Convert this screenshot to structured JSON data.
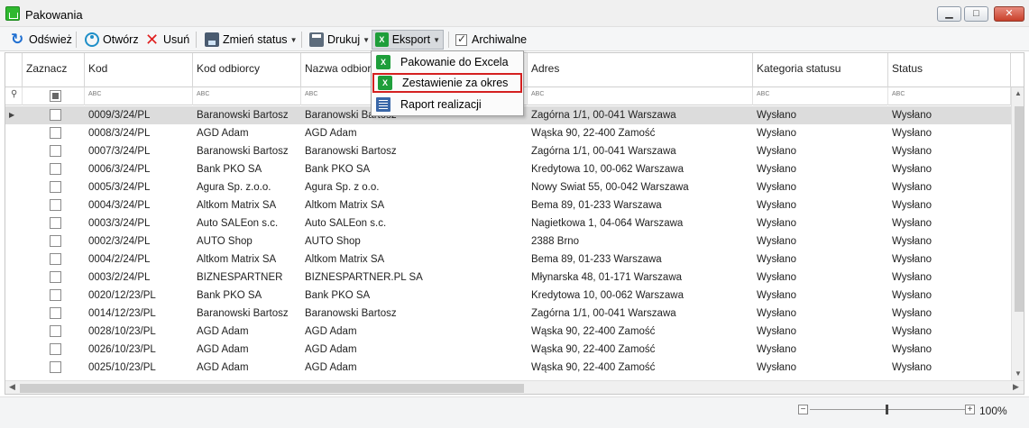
{
  "window": {
    "title": "Pakowania",
    "min_icon": "minimize-icon",
    "max_icon": "maximize-icon",
    "close_icon": "close-icon"
  },
  "toolbar": {
    "refresh": "Odśwież",
    "open": "Otwórz",
    "delete": "Usuń",
    "change_status": "Zmień status",
    "print": "Drukuj",
    "export": "Eksport",
    "archival": "Archiwalne",
    "archival_checked": true
  },
  "export_menu": {
    "items": [
      {
        "label": "Pakowanie do Excela",
        "icon": "excel-icon"
      },
      {
        "label": "Zestawienie za okres",
        "icon": "excel-icon"
      },
      {
        "label": "Raport realizacji",
        "icon": "report-icon"
      }
    ]
  },
  "grid": {
    "columns": [
      "Zaznacz",
      "Kod",
      "Kod odbiorcy",
      "Nazwa odbiorcy",
      "Adres",
      "Kategoria statusu",
      "Status"
    ],
    "filter_hint": "ABC",
    "rows": [
      {
        "kod": "0009/3/24/PL",
        "kod_odbiorcy": "Baranowski Bartosz",
        "nazwa": "Baranowski Bartosz",
        "adres": "Zagórna 1/1, 00-041 Warszawa",
        "kategoria": "Wysłano",
        "status": "Wysłano"
      },
      {
        "kod": "0008/3/24/PL",
        "kod_odbiorcy": "AGD Adam",
        "nazwa": "AGD Adam",
        "adres": "Wąska 90, 22-400 Zamość",
        "kategoria": "Wysłano",
        "status": "Wysłano"
      },
      {
        "kod": "0007/3/24/PL",
        "kod_odbiorcy": "Baranowski Bartosz",
        "nazwa": "Baranowski Bartosz",
        "adres": "Zagórna 1/1, 00-041 Warszawa",
        "kategoria": "Wysłano",
        "status": "Wysłano"
      },
      {
        "kod": "0006/3/24/PL",
        "kod_odbiorcy": "Bank PKO SA",
        "nazwa": "Bank PKO SA",
        "adres": "Kredytowa 10, 00-062 Warszawa",
        "kategoria": "Wysłano",
        "status": "Wysłano"
      },
      {
        "kod": "0005/3/24/PL",
        "kod_odbiorcy": "Agura Sp. z.o.o.",
        "nazwa": "Agura Sp. z o.o.",
        "adres": "Nowy Swiat 55, 00-042 Warszawa",
        "kategoria": "Wysłano",
        "status": "Wysłano"
      },
      {
        "kod": "0004/3/24/PL",
        "kod_odbiorcy": "Altkom Matrix SA",
        "nazwa": "Altkom Matrix SA",
        "adres": "Bema 89, 01-233 Warszawa",
        "kategoria": "Wysłano",
        "status": "Wysłano"
      },
      {
        "kod": "0003/3/24/PL",
        "kod_odbiorcy": "Auto SALEon s.c.",
        "nazwa": "Auto SALEon s.c.",
        "adres": "Nagietkowa 1, 04-064 Warszawa",
        "kategoria": "Wysłano",
        "status": "Wysłano"
      },
      {
        "kod": "0002/3/24/PL",
        "kod_odbiorcy": "AUTO Shop",
        "nazwa": "AUTO Shop",
        "adres": "2388 Brno",
        "kategoria": "Wysłano",
        "status": "Wysłano"
      },
      {
        "kod": "0004/2/24/PL",
        "kod_odbiorcy": "Altkom Matrix SA",
        "nazwa": "Altkom Matrix SA",
        "adres": "Bema 89, 01-233 Warszawa",
        "kategoria": "Wysłano",
        "status": "Wysłano"
      },
      {
        "kod": "0003/2/24/PL",
        "kod_odbiorcy": "BIZNESPARTNER",
        "nazwa": "BIZNESPARTNER.PL SA",
        "adres": "Młynarska 48, 01-171 Warszawa",
        "kategoria": "Wysłano",
        "status": "Wysłano"
      },
      {
        "kod": "0020/12/23/PL",
        "kod_odbiorcy": "Bank PKO SA",
        "nazwa": "Bank PKO SA",
        "adres": "Kredytowa 10, 00-062 Warszawa",
        "kategoria": "Wysłano",
        "status": "Wysłano"
      },
      {
        "kod": "0014/12/23/PL",
        "kod_odbiorcy": "Baranowski Bartosz",
        "nazwa": "Baranowski Bartosz",
        "adres": "Zagórna 1/1, 00-041 Warszawa",
        "kategoria": "Wysłano",
        "status": "Wysłano"
      },
      {
        "kod": "0028/10/23/PL",
        "kod_odbiorcy": "AGD Adam",
        "nazwa": "AGD Adam",
        "adres": "Wąska 90, 22-400 Zamość",
        "kategoria": "Wysłano",
        "status": "Wysłano"
      },
      {
        "kod": "0026/10/23/PL",
        "kod_odbiorcy": "AGD Adam",
        "nazwa": "AGD Adam",
        "adres": "Wąska 90, 22-400 Zamość",
        "kategoria": "Wysłano",
        "status": "Wysłano"
      },
      {
        "kod": "0025/10/23/PL",
        "kod_odbiorcy": "AGD Adam",
        "nazwa": "AGD Adam",
        "adres": "Wąska 90, 22-400 Zamość",
        "kategoria": "Wysłano",
        "status": "Wysłano"
      }
    ]
  },
  "zoom": {
    "label": "100%",
    "minus": "−",
    "plus": "+"
  },
  "colors": {
    "accent_red": "#d42020",
    "excel_green": "#1e9e3a",
    "selected_row": "#dcdcdc"
  }
}
